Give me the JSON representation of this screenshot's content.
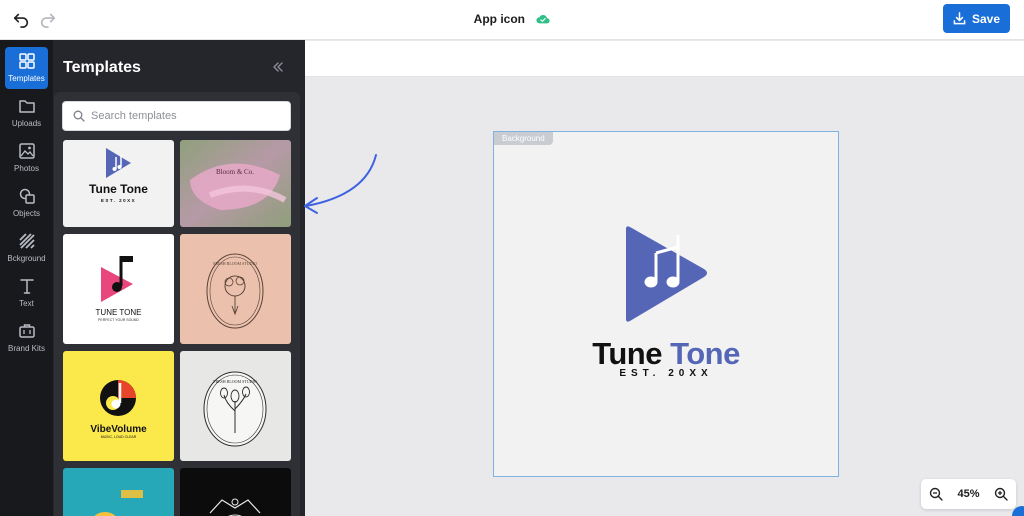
{
  "header": {
    "title": "App icon",
    "save_label": "Save"
  },
  "rail": {
    "items": [
      {
        "label": "Templates",
        "icon": "grid-icon"
      },
      {
        "label": "Uploads",
        "icon": "folder-icon"
      },
      {
        "label": "Photos",
        "icon": "image-icon"
      },
      {
        "label": "Objects",
        "icon": "shapes-icon"
      },
      {
        "label": "Bckground",
        "icon": "stripes-icon"
      },
      {
        "label": "Text",
        "icon": "text-icon"
      },
      {
        "label": "Brand Kits",
        "icon": "briefcase-icon"
      }
    ]
  },
  "panel": {
    "title": "Templates",
    "search_placeholder": "Search templates"
  },
  "templates": [
    {
      "name": "Tune Tone",
      "sub": "EST. 20XX"
    },
    {
      "name": "Bloom & Co."
    },
    {
      "name": "TUNE TONE",
      "sub": "PERFECT YOUR SOUND"
    },
    {
      "name": "FRESH BLOOM STUDIO"
    },
    {
      "name": "VibeVolume",
      "sub": "MUSIC, LOUD CLEAR"
    },
    {
      "name": "FRESH BLOOM STUDIO"
    }
  ],
  "canvas": {
    "background_tag": "Background",
    "logo_word1": "Tune",
    "logo_word2": "Tone",
    "logo_sub": "EST. 20XX"
  },
  "zoom": {
    "level": "45%"
  },
  "colors": {
    "accent": "#1a6ed8",
    "brand": "#5466b5",
    "cloud_ok": "#2fbf8a"
  }
}
